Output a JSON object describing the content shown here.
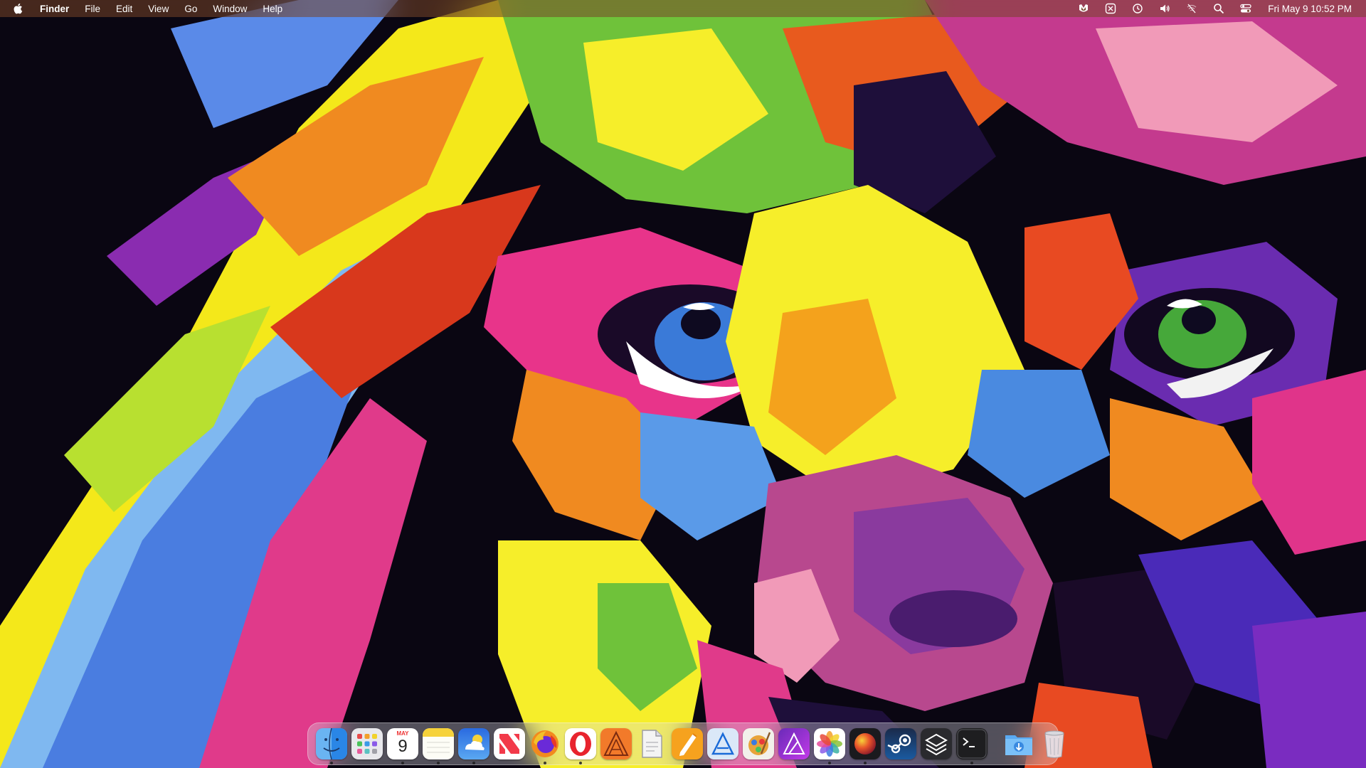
{
  "menubar": {
    "app_name": "Finder",
    "menus": [
      "File",
      "Edit",
      "View",
      "Go",
      "Window",
      "Help"
    ],
    "status_icons": [
      "malwarebytes-icon",
      "grid-app-icon",
      "time-machine-icon",
      "volume-icon",
      "wifi-off-icon",
      "search-icon",
      "control-center-icon"
    ],
    "clock": "Fri May 9  10:52 PM"
  },
  "dock": {
    "calendar": {
      "month": "MAY",
      "day": "9"
    },
    "apps": [
      {
        "name": "Finder",
        "icon": "finder-icon",
        "running": true
      },
      {
        "name": "Launchpad",
        "icon": "launchpad-icon",
        "running": false
      },
      {
        "name": "Calendar",
        "icon": "calendar-icon",
        "running": true
      },
      {
        "name": "Notes",
        "icon": "notes-icon",
        "running": true
      },
      {
        "name": "Weather",
        "icon": "weather-icon",
        "running": true
      },
      {
        "name": "News",
        "icon": "news-icon",
        "running": false
      },
      {
        "name": "Firefox",
        "icon": "firefox-icon",
        "running": true
      },
      {
        "name": "Opera",
        "icon": "opera-icon",
        "running": true
      },
      {
        "name": "Sketch-like app",
        "icon": "orange-app-icon",
        "running": false
      },
      {
        "name": "Preview",
        "icon": "document-icon",
        "running": false
      },
      {
        "name": "Pages",
        "icon": "pencil-icon",
        "running": false
      },
      {
        "name": "Xcode-like app",
        "icon": "blue-triangle-icon",
        "running": false
      },
      {
        "name": "Pixelmator",
        "icon": "brush-icon",
        "running": false
      },
      {
        "name": "Affinity",
        "icon": "affinity-icon",
        "running": false
      },
      {
        "name": "Photos",
        "icon": "photos-icon",
        "running": true
      },
      {
        "name": "Orb",
        "icon": "orb-icon",
        "running": true
      },
      {
        "name": "Steam",
        "icon": "steam-icon",
        "running": false
      },
      {
        "name": "Layers",
        "icon": "layers-icon",
        "running": false
      },
      {
        "name": "Terminal",
        "icon": "terminal-icon",
        "running": true
      }
    ],
    "extras": [
      {
        "name": "Downloads",
        "icon": "downloads-folder-icon"
      },
      {
        "name": "Trash",
        "icon": "trash-icon"
      }
    ]
  },
  "colors": {
    "menubar_bg": "#78462855",
    "accent": "#ffffff"
  }
}
